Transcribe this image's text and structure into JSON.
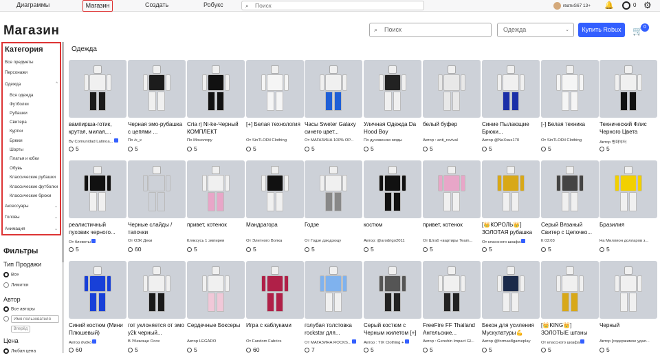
{
  "topnav": {
    "items": [
      "Диаграммы",
      "Магазин",
      "Создать",
      "Робукс"
    ],
    "search_placeholder": "Поиск",
    "username": "rватиS67 13+",
    "robux": "0"
  },
  "header": {
    "title": "Магазин",
    "search_placeholder": "Поиск",
    "category_select": "Одежда",
    "buy_robux": "Купить Robux",
    "cart_count": "0"
  },
  "sidebar": {
    "category_title": "Категория",
    "top_items": [
      "Все предметы",
      "Персонажи",
      "Одежда"
    ],
    "clothing_sub": [
      "Вся одежда",
      "Футболки",
      "Рубашки",
      "Свитера",
      "Куртки",
      "Брюки",
      "Шорты",
      "Платья и юбки",
      "Обувь",
      "Классические рубашки",
      "Классические футболки",
      "Классические брюки"
    ],
    "bottom_items": [
      "Аксессуары",
      "Головы",
      "Анимация"
    ],
    "filters_title": "Фильтры",
    "sale_type_label": "Тип Продажи",
    "sale_options": [
      "Все",
      "Лимитки"
    ],
    "author_label": "Автор",
    "author_options": [
      "Все авторы",
      "Имя пользователя"
    ],
    "go_button": "Вперёд",
    "price_label": "Цена",
    "price_option": "Любая цена"
  },
  "section_title": "Одежда",
  "items": [
    {
      "title": "вампирша-готик, крутая, милая,...",
      "by": "By Comunidad Latinoa...",
      "verified": true,
      "price": "5",
      "torso": "#f0f0f0",
      "legs": "#1a1a1a",
      "arms": "#f0f0f0"
    },
    {
      "title": "Черная эмо-рубашка с цепями ...",
      "by": "По /x_x",
      "verified": false,
      "price": "5",
      "torso": "#1c1c1c",
      "legs": "#f0f0f0",
      "arms": "#f0f0f0"
    },
    {
      "title": "Cria rj Ni-ke-Черный КОМПЛЕКТ",
      "by": "По Монолору",
      "verified": false,
      "price": "5",
      "torso": "#111111",
      "legs": "#111111",
      "arms": "#f0f0f0"
    },
    {
      "title": "[+] Белая технология",
      "by": "От SinTLORil Clothing",
      "verified": false,
      "price": "5",
      "torso": "#f5f5f5",
      "legs": "#f5f5f5",
      "arms": "#f5f5f5"
    },
    {
      "title": "Часы Sweter Galaxy синего цвет...",
      "by": "От МАГАЗИНА 100% OP...",
      "verified": false,
      "price": "5",
      "torso": "#f0f0f0",
      "legs": "#1f5fd6",
      "arms": "#f0f0f0"
    },
    {
      "title": "Уличная Одежда Da Hood Boy",
      "by": "По дуновению моды",
      "verified": false,
      "price": "5",
      "torso": "#222222",
      "legs": "#f0f0f0",
      "arms": "#f0f0f0"
    },
    {
      "title": "белый буфер",
      "by": "Автор : anti_revival",
      "verified": false,
      "price": "5",
      "torso": "#e8e8e8",
      "legs": "#e8e8e8",
      "arms": "#e8e8e8"
    },
    {
      "title": "Синие Пылающие Брюки...",
      "by": "Автор @NeXsus170",
      "verified": false,
      "price": "5",
      "torso": "#f0f0f0",
      "legs": "#1b2fa8",
      "arms": "#f0f0f0"
    },
    {
      "title": "[-] Белая техника",
      "by": "От SinTLORil Clothing",
      "verified": false,
      "price": "5",
      "torso": "#f5f5f5",
      "legs": "#f5f5f5",
      "arms": "#f5f5f5"
    },
    {
      "title": "Технический Флис Черного Цвета",
      "by": "Автор 병화부터",
      "verified": false,
      "price": "5",
      "torso": "#f0f0f0",
      "legs": "#111111",
      "arms": "#f0f0f0"
    },
    {
      "title": "реалистичный пуховик черного...",
      "by": "От блевоты",
      "verified": true,
      "price": "5",
      "torso": "#111111",
      "legs": "#f0f0f0",
      "arms": "#111111"
    },
    {
      "title": "Черные слайды / тапочки",
      "by": "От ОЗК Деки",
      "verified": false,
      "price": "60",
      "torso": "#cdd1d8",
      "legs": "#cdd1d8",
      "arms": "#cdd1d8"
    },
    {
      "title": "привет, котенок",
      "by": "Кляксусь 1 эмпиреи",
      "verified": false,
      "price": "5",
      "torso": "#f0f0f0",
      "legs": "#e8a6c8",
      "arms": "#f0f0f0"
    },
    {
      "title": "Мандрагора",
      "by": "От Элитного Волка",
      "verified": false,
      "price": "5",
      "torso": "#111111",
      "legs": "#f0f0f0",
      "arms": "#f0f0f0"
    },
    {
      "title": "Годзе",
      "by": "От Годзе дзюдзюцу",
      "verified": false,
      "price": "5",
      "torso": "#f0f0f0",
      "legs": "#888888",
      "arms": "#f0f0f0"
    },
    {
      "title": "костюм",
      "by": "Автор: @arodrigo2011",
      "verified": false,
      "price": "5",
      "torso": "#111111",
      "legs": "#111111",
      "arms": "#111111"
    },
    {
      "title": "привет, котенок",
      "by": "От Штаб «вартиры Team...",
      "verified": false,
      "price": "5",
      "torso": "#e8a6c8",
      "legs": "#f0f0f0",
      "arms": "#e8a6c8"
    },
    {
      "title": "[👑КОРОЛЬ👑] ЗОЛОТАЯ рубашка",
      "by": "От классного шкафа",
      "verified": true,
      "price": "5",
      "torso": "#d8a818",
      "legs": "#f0f0f0",
      "arms": "#d8a818"
    },
    {
      "title": "Серый Вязаный Свитер с Цепочко...",
      "by": "К 03:03",
      "verified": false,
      "price": "5",
      "torso": "#444444",
      "legs": "#f0f0f0",
      "arms": "#444444"
    },
    {
      "title": "Бразилия",
      "by": "На Миллион долларов з...",
      "verified": false,
      "price": "5",
      "torso": "#f2d000",
      "legs": "#f0f0f0",
      "arms": "#f2d000"
    },
    {
      "title": "Синий костюм (Мини Плюшевый)",
      "by": "Автор dvdko",
      "verified": true,
      "price": "60",
      "torso": "#1840d8",
      "legs": "#1840d8",
      "arms": "#1840d8"
    },
    {
      "title": "гот уклоняется от эмо y2k черный...",
      "by": "В Убежище Осох",
      "verified": false,
      "price": "5",
      "torso": "#f0f0f0",
      "legs": "#1a1a1a",
      "arms": "#f0f0f0"
    },
    {
      "title": "Сердечные Боксеры",
      "by": "Автор LEGADO",
      "verified": false,
      "price": "5",
      "torso": "#f0f0f0",
      "legs": "#f0c8d8",
      "arms": "#f0f0f0"
    },
    {
      "title": "Игра с каблуками",
      "by": "От Fandom Fabrics",
      "verified": false,
      "price": "60",
      "torso": "#b02048",
      "legs": "#b02048",
      "arms": "#b02048"
    },
    {
      "title": "голубая толстовка rockstar для...",
      "by": "От МАГАЗИНА ROCKS...",
      "verified": true,
      "price": "7",
      "torso": "#7fb2ee",
      "legs": "#f0f0f0",
      "arms": "#7fb2ee"
    },
    {
      "title": "Серый костюм с Черным жилетом [+]",
      "by": "Автор : TIX Clothing +",
      "verified": true,
      "price": "5",
      "torso": "#555555",
      "legs": "#222222",
      "arms": "#555555"
    },
    {
      "title": "FreeFire FF Thailand Ангельские...",
      "by": "Автор : Genshin Impact Gl...",
      "verified": false,
      "price": "5",
      "torso": "#f0f0f0",
      "legs": "#222222",
      "arms": "#f0f0f0"
    },
    {
      "title": "Бекон для усиления Мускулатуры💪",
      "by": "Автор @formas8gameplay",
      "verified": false,
      "price": "5",
      "torso": "#1a2a4a",
      "legs": "#f0f0f0",
      "arms": "#f0f0f0"
    },
    {
      "title": "[👑KING👑] ЗОЛОТЫЕ штаны",
      "by": "От классного шкафа",
      "verified": true,
      "price": "5",
      "torso": "#f0f0f0",
      "legs": "#d8a818",
      "arms": "#f0f0f0"
    },
    {
      "title": "Черный",
      "by": "Автор [содержимое удал...",
      "verified": false,
      "price": "5",
      "torso": "#f0f0f0",
      "legs": "#f0f0f0",
      "arms": "#f0f0f0"
    }
  ]
}
